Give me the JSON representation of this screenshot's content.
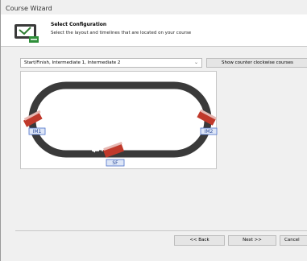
{
  "window": {
    "title": "Course Wizard"
  },
  "header": {
    "title": "Select Configuration",
    "subtitle": "Select the layout and timelines that are located on your course",
    "icon": "course-wizard-icon"
  },
  "config": {
    "selected": "Start/Finish, Intermediate 1, Intermediate 2",
    "ccw_label": "Show counter clockwise courses"
  },
  "track": {
    "labels": {
      "im1": "IM1",
      "im2": "IM2",
      "sf": "SF"
    },
    "direction": "counter-clockwise arrow",
    "colors": {
      "track": "#3a3a3a",
      "timeline": "#c0392b",
      "label_border": "#4a6fc9"
    }
  },
  "footer": {
    "back": "<< Back",
    "next": "Next >>",
    "cancel": "Cancel"
  }
}
